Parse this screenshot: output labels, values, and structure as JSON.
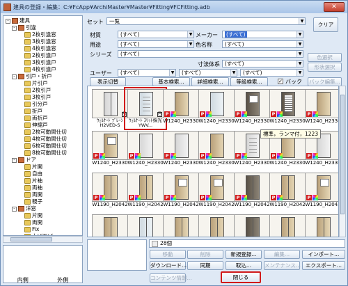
{
  "window": {
    "title": "建具の登録・編集：C:¥FcApp¥ArchiMaster¥Master¥Fitting¥FCFitting.adb",
    "close_label": "✕"
  },
  "tree": {
    "nodes": [
      {
        "label": "建具",
        "level": 0,
        "icon": "tool",
        "box": "-"
      },
      {
        "label": "引違",
        "level": 1,
        "icon": "tool",
        "box": "-"
      },
      {
        "label": "2枚引違窓",
        "level": 2,
        "icon": "folder"
      },
      {
        "label": "3枚引違窓",
        "level": 2,
        "icon": "folder"
      },
      {
        "label": "4枚引違窓",
        "level": 2,
        "icon": "folder"
      },
      {
        "label": "2枚引違戸",
        "level": 2,
        "icon": "folder"
      },
      {
        "label": "3枚引違戸",
        "level": 2,
        "icon": "folder"
      },
      {
        "label": "4枚引違戸",
        "level": 2,
        "icon": "folder"
      },
      {
        "label": "引戸・折戸",
        "level": 1,
        "icon": "tool",
        "box": "-"
      },
      {
        "label": "片引戸",
        "level": 2,
        "icon": "folder"
      },
      {
        "label": "2枚引戸",
        "level": 2,
        "icon": "folder"
      },
      {
        "label": "3枚引戸",
        "level": 2,
        "icon": "folder"
      },
      {
        "label": "引分戸",
        "level": 2,
        "icon": "folder"
      },
      {
        "label": "折戸",
        "level": 2,
        "icon": "folder"
      },
      {
        "label": "両折戸",
        "level": 2,
        "icon": "folder"
      },
      {
        "label": "伸縮戸",
        "level": 2,
        "icon": "folder"
      },
      {
        "label": "2枚可動間仕切",
        "level": 2,
        "icon": "folder"
      },
      {
        "label": "4枚可動間仕切",
        "level": 2,
        "icon": "folder"
      },
      {
        "label": "6枚可動間仕切",
        "level": 2,
        "icon": "folder"
      },
      {
        "label": "8枚可動間仕切",
        "level": 2,
        "icon": "folder"
      },
      {
        "label": "ドア",
        "level": 1,
        "icon": "tool",
        "box": "-"
      },
      {
        "label": "片開",
        "level": 2,
        "icon": "folder"
      },
      {
        "label": "自由",
        "level": 2,
        "icon": "folder"
      },
      {
        "label": "片袖",
        "level": 2,
        "icon": "folder"
      },
      {
        "label": "両袖",
        "level": 2,
        "icon": "folder"
      },
      {
        "label": "両開",
        "level": 2,
        "icon": "folder"
      },
      {
        "label": "親子",
        "level": 2,
        "icon": "folder"
      },
      {
        "label": "洋窓",
        "level": 1,
        "icon": "tool",
        "box": "-"
      },
      {
        "label": "片開",
        "level": 2,
        "icon": "folder"
      },
      {
        "label": "両開",
        "level": 2,
        "icon": "folder"
      },
      {
        "label": "Fix",
        "level": 2,
        "icon": "folder"
      },
      {
        "label": "上げ下げ",
        "level": 2,
        "icon": "folder"
      }
    ],
    "tab_inner": "内側",
    "tab_outer": "外側"
  },
  "filters": {
    "set_label": "セット",
    "set_value": "一覧",
    "clear_label": "クリア",
    "material_label": "材質",
    "material_value": "(すべて)",
    "maker_label": "メーカー",
    "maker_value": "(すべて)",
    "use_label": "用途",
    "use_value": "(すべて)",
    "color_label": "色名称",
    "color_value": "(すべて)",
    "series_label": "シリーズ",
    "series_value": "(すべて)",
    "color_select_label": "色選択",
    "shape_select_label": "形状選択",
    "dimension_label": "寸法体系",
    "dimension_value": "(すべて)",
    "user_label": "ユーザー",
    "user_value_1": "(すべて)",
    "user_value_2": "(すべて)",
    "user_value_3": "(すべて)"
  },
  "toolbar": {
    "display_toggle": "表示切替",
    "basic_search": "基本検索...",
    "detail_search": "詳細検索...",
    "equivalent_search": "等級検索...",
    "back_checkbox_label": "バック",
    "back_checked": true,
    "back_edit": "バック編集..."
  },
  "items": [
    {
      "caption": "ｳｪﾙﾅｰﾄ ﾌﾟﾚｰﾝ H2VED-S",
      "style": "white split",
      "p": false,
      "g": true
    },
    {
      "caption": "ｳｪﾙﾅｰﾄ ｽﾘｯﾄ採光 YWV...",
      "style": "glass lines",
      "p": false,
      "g": true,
      "highlight": true
    },
    {
      "caption": "W1240_H2330",
      "style": "wood",
      "p": true
    },
    {
      "caption": "W1240_H2330",
      "style": "glass",
      "p": true
    },
    {
      "caption": "W1240_H2330",
      "style": "dark win",
      "p": true
    },
    {
      "caption": "W1240_H2330",
      "style": "dark slats",
      "p": true
    },
    {
      "caption": "W1240_H2330",
      "style": "wood",
      "p": true
    },
    {
      "caption": "W1240_H2330",
      "style": "wood win",
      "p": true
    },
    {
      "caption": "W1240_H2330",
      "style": "white",
      "p": true
    },
    {
      "caption": "W1240_H2330",
      "style": "white",
      "p": true
    },
    {
      "caption": "W1240_H2330",
      "style": "wood",
      "p": true
    },
    {
      "caption": "W1240_H2330",
      "style": "white lines",
      "p": true
    },
    {
      "caption": "W1240_H2330",
      "style": "wood",
      "p": true
    },
    {
      "caption": "W1240_H2330",
      "style": "white",
      "p": true
    },
    {
      "caption": "W1190_H2042",
      "style": "wood split",
      "p": true
    },
    {
      "caption": "W1190_H2042",
      "style": "wood split",
      "p": true
    },
    {
      "caption": "W1190_H2042",
      "style": "wood win",
      "p": true
    },
    {
      "caption": "W1190_H2042",
      "style": "wood win",
      "p": true
    },
    {
      "caption": "W1190_H2042",
      "style": "dark split",
      "p": true
    },
    {
      "caption": "W1190_H2042",
      "style": "wood split",
      "p": true
    },
    {
      "caption": "W1190_H2042",
      "style": "wood win",
      "p": true
    },
    {
      "caption": "",
      "style": "wood split",
      "p": false
    },
    {
      "caption": "",
      "style": "glass split",
      "p": false
    },
    {
      "caption": "",
      "style": "wood split",
      "p": false
    },
    {
      "caption": "",
      "style": "wood split",
      "p": false
    },
    {
      "caption": "",
      "style": "dark split",
      "p": false
    },
    {
      "caption": "",
      "style": "wood split",
      "p": false
    },
    {
      "caption": "",
      "style": "wood split",
      "p": false
    }
  ],
  "tooltip": "標準，ランマ付，1223",
  "count_text": "28個",
  "bottom": {
    "move": "移動",
    "delete": "削除",
    "new_register": "新規登録...",
    "edit": "編集...",
    "import": "インポート...",
    "download": "ダウンロード...",
    "sync": "同期",
    "fetch": "取込...",
    "maintenance": "メンテナンス...",
    "export": "エクスポート...",
    "contents_info": "コンテンツ情報...",
    "close": "閉じる"
  },
  "colors": {
    "highlight": "#d11a1a",
    "selection": "#3b6fd4"
  }
}
